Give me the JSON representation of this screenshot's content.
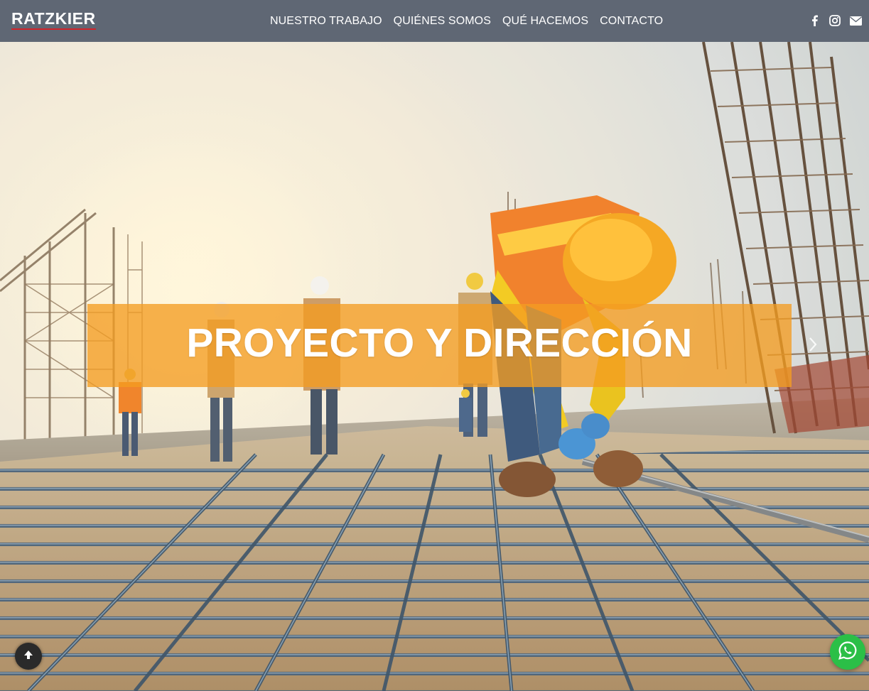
{
  "header": {
    "logo_text": "RATZKIER",
    "nav": [
      {
        "label": "NUESTRO TRABAJO"
      },
      {
        "label": "QUIÉNES SOMOS"
      },
      {
        "label": "QUÉ HACEMOS"
      },
      {
        "label": "CONTACTO"
      }
    ],
    "social": [
      {
        "icon": "facebook-icon"
      },
      {
        "icon": "instagram-icon"
      },
      {
        "icon": "envelope-icon"
      }
    ]
  },
  "hero": {
    "caption": "PROYECTO Y DIRECCIÓN",
    "next_icon": "chevron-right-icon"
  },
  "floating": {
    "scroll_top_icon": "arrow-up-icon",
    "whatsapp_icon": "whatsapp-icon"
  },
  "colors": {
    "header_bg": "#5f6774",
    "logo_accent": "#d2232a",
    "caption_bg": "#f39c21",
    "whatsapp": "#2bbf47"
  }
}
